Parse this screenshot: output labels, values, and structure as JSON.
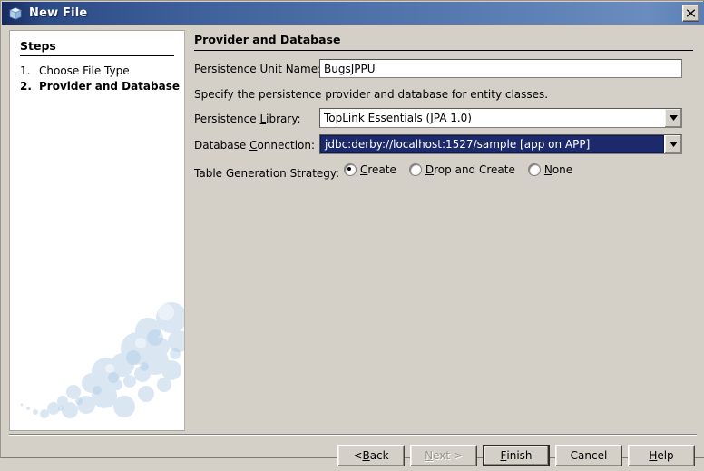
{
  "window": {
    "title": "New File",
    "icon": "cube-icon",
    "close_label": "×"
  },
  "steps_panel": {
    "heading": "Steps",
    "items": [
      {
        "number": "1.",
        "label": "Choose File Type",
        "current": false
      },
      {
        "number": "2.",
        "label": "Provider and Database",
        "current": true
      }
    ]
  },
  "content": {
    "heading": "Provider and Database",
    "persistence_unit": {
      "label_pre": "Persistence ",
      "label_mn": "U",
      "label_post": "nit Name:",
      "value": "BugsJPPU",
      "placeholder": ""
    },
    "description": "Specify the persistence provider and database for entity classes.",
    "persistence_library": {
      "label_pre": "Persistence ",
      "label_mn": "L",
      "label_post": "ibrary:",
      "value": "TopLink Essentials (JPA 1.0)",
      "options": [
        "TopLink Essentials (JPA 1.0)"
      ]
    },
    "database_connection": {
      "label_pre": "Database ",
      "label_mn": "C",
      "label_post": "onnection:",
      "value": "jdbc:derby://localhost:1527/sample [app on APP]",
      "options": [
        "jdbc:derby://localhost:1527/sample [app on APP]"
      ],
      "selected": true
    },
    "table_generation": {
      "label": "Table Generation Strategy:",
      "options": [
        {
          "pre": "",
          "mn": "C",
          "post": "reate",
          "checked": true
        },
        {
          "pre": "",
          "mn": "D",
          "post": "rop and Create",
          "checked": false
        },
        {
          "pre": "",
          "mn": "N",
          "post": "one",
          "checked": false
        }
      ]
    }
  },
  "buttons": [
    {
      "pre": "< ",
      "mn": "B",
      "post": "ack",
      "state": "normal"
    },
    {
      "pre": "",
      "mn": "N",
      "post": "ext >",
      "state": "disabled"
    },
    {
      "pre": "",
      "mn": "F",
      "post": "inish",
      "state": "default"
    },
    {
      "pre": "Cancel",
      "mn": "",
      "post": "",
      "state": "normal"
    },
    {
      "pre": "",
      "mn": "H",
      "post": "elp",
      "state": "normal"
    }
  ],
  "colors": {
    "titlebar_start": "#15295e",
    "titlebar_end": "#6a8cbe",
    "dialog_bg": "#d4d0c8",
    "selection_bg": "#1c2a6b",
    "panel_bg": "#ffffff",
    "bubble": "#bcd5ea"
  }
}
